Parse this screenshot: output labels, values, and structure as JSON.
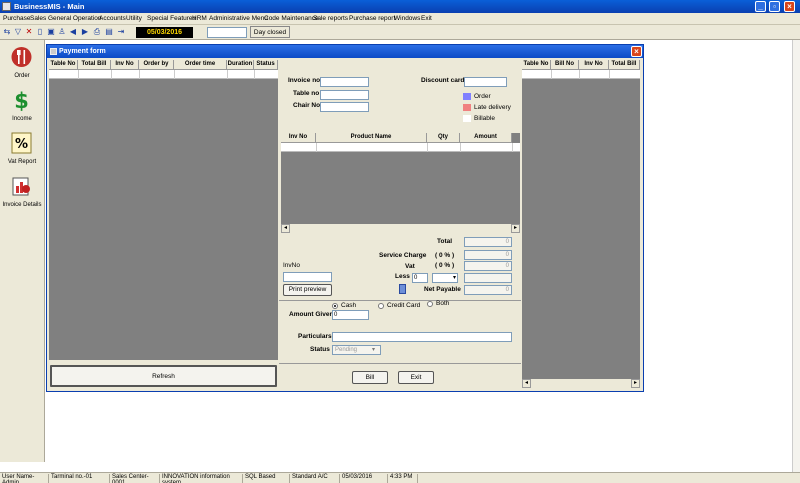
{
  "window": {
    "title": "BusinessMIS - Main"
  },
  "menu": [
    "Purchase",
    "Sales",
    "General Operation",
    "Accounts",
    "Utility",
    "Special Features",
    "HRM",
    "Administrative Menu",
    "Code Maintenance",
    "Sale reports",
    "Purchase report",
    "Windows",
    "Exit"
  ],
  "toolbar": {
    "date": "05/03/2016",
    "day_closed": "Day closed"
  },
  "leftnav": [
    {
      "label": "Order",
      "icon": "fork-knife-icon"
    },
    {
      "label": "Income",
      "icon": "dollar-icon"
    },
    {
      "label": "Vat Report",
      "icon": "percent-icon"
    },
    {
      "label": "Invoice Details",
      "icon": "invoice-chart-icon"
    }
  ],
  "payment_form": {
    "title": "Payment form",
    "left_grid": {
      "columns": [
        "Table No",
        "Total Bill",
        "Inv No",
        "Order by",
        "Order time",
        "Duration",
        "Status"
      ]
    },
    "right_grid": {
      "columns": [
        "Table No",
        "Bill No",
        "Inv No",
        "Total Bill"
      ]
    },
    "fields": {
      "invoice_no": "Invoice no",
      "table_no": "Table no",
      "chair_no": "Chair No",
      "discount_card": "Discount card"
    },
    "legend": [
      {
        "label": "Order",
        "color": "#8080ff"
      },
      {
        "label": "Late delivery",
        "color": "#f08080"
      },
      {
        "label": "Billable",
        "color": "#ffffff"
      }
    ],
    "product_grid": {
      "columns": [
        "Inv No",
        "Product Name",
        "Qty",
        "Amount"
      ]
    },
    "totals": {
      "total": "Total",
      "service_charge": "Service Charge",
      "service_pct": "( 0 % )",
      "vat": "Vat",
      "vat_pct": "( 0 % )",
      "less": "Less",
      "less_value": "0",
      "net_payable": "Net Payable",
      "zero": "0"
    },
    "invno_label": "InvNo",
    "print_preview": "Print preview",
    "payment_types": [
      {
        "label": "Cash",
        "selected": true
      },
      {
        "label": "Credit Card",
        "selected": false
      },
      {
        "label": "Both",
        "selected": false
      }
    ],
    "amount_given": {
      "label": "Amount Given",
      "value": "0"
    },
    "particulars": "Particulars",
    "status": {
      "label": "Status",
      "value": "Pending"
    },
    "refresh": "Refresh",
    "bill": "Bill",
    "exit": "Exit"
  },
  "statusbar": [
    "User Name-Admin",
    "Tarminal no.-01",
    "Sales Center-0001",
    "INNOVATION information system",
    "SQL Based",
    "Standard A/C",
    "05/03/2016",
    "4:33 PM"
  ]
}
